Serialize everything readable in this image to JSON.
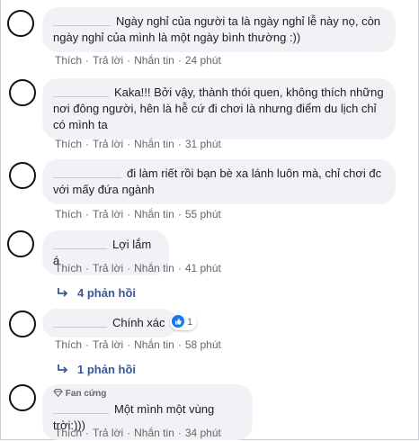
{
  "labels": {
    "like": "Thích",
    "reply": "Trả lời",
    "message": "Nhắn tin"
  },
  "comments": [
    {
      "text": "Ngày nghỉ của người ta là ngày nghỉ lễ này nọ, còn ngày nghỉ của mình là một ngày bình thường :))",
      "time": "24 phút"
    },
    {
      "text": "Kaka!!! Bởi vậy, thành thói quen, không thích những nơi đông người, hên là hễ cứ đi chơi là nhưng điểm du lịch chỉ có mình ta",
      "time": "31 phút"
    },
    {
      "text": "đi làm riết rồi bạn bè xa lánh luôn mà, chỉ chơi đc với mấy đứa ngành",
      "time": "55 phút"
    },
    {
      "text": "Lợi lắm á",
      "time": "41 phút",
      "replies": "4 phản hồi"
    },
    {
      "text": "Chính xác",
      "time": "58 phút",
      "replies": "1 phản hồi",
      "reaction_count": "1"
    },
    {
      "badge": "Fan cứng",
      "text": "Một mình một vùng trời:)))",
      "time": "34 phút"
    }
  ],
  "icons": {
    "reaction": "like-icon",
    "reply_arrow": "reply-arrow-icon",
    "badge": "diamond-icon"
  },
  "colors": {
    "bubble": "#f0f2f5",
    "link": "#385898",
    "meta": "#65676b",
    "like": "#1877f2"
  }
}
